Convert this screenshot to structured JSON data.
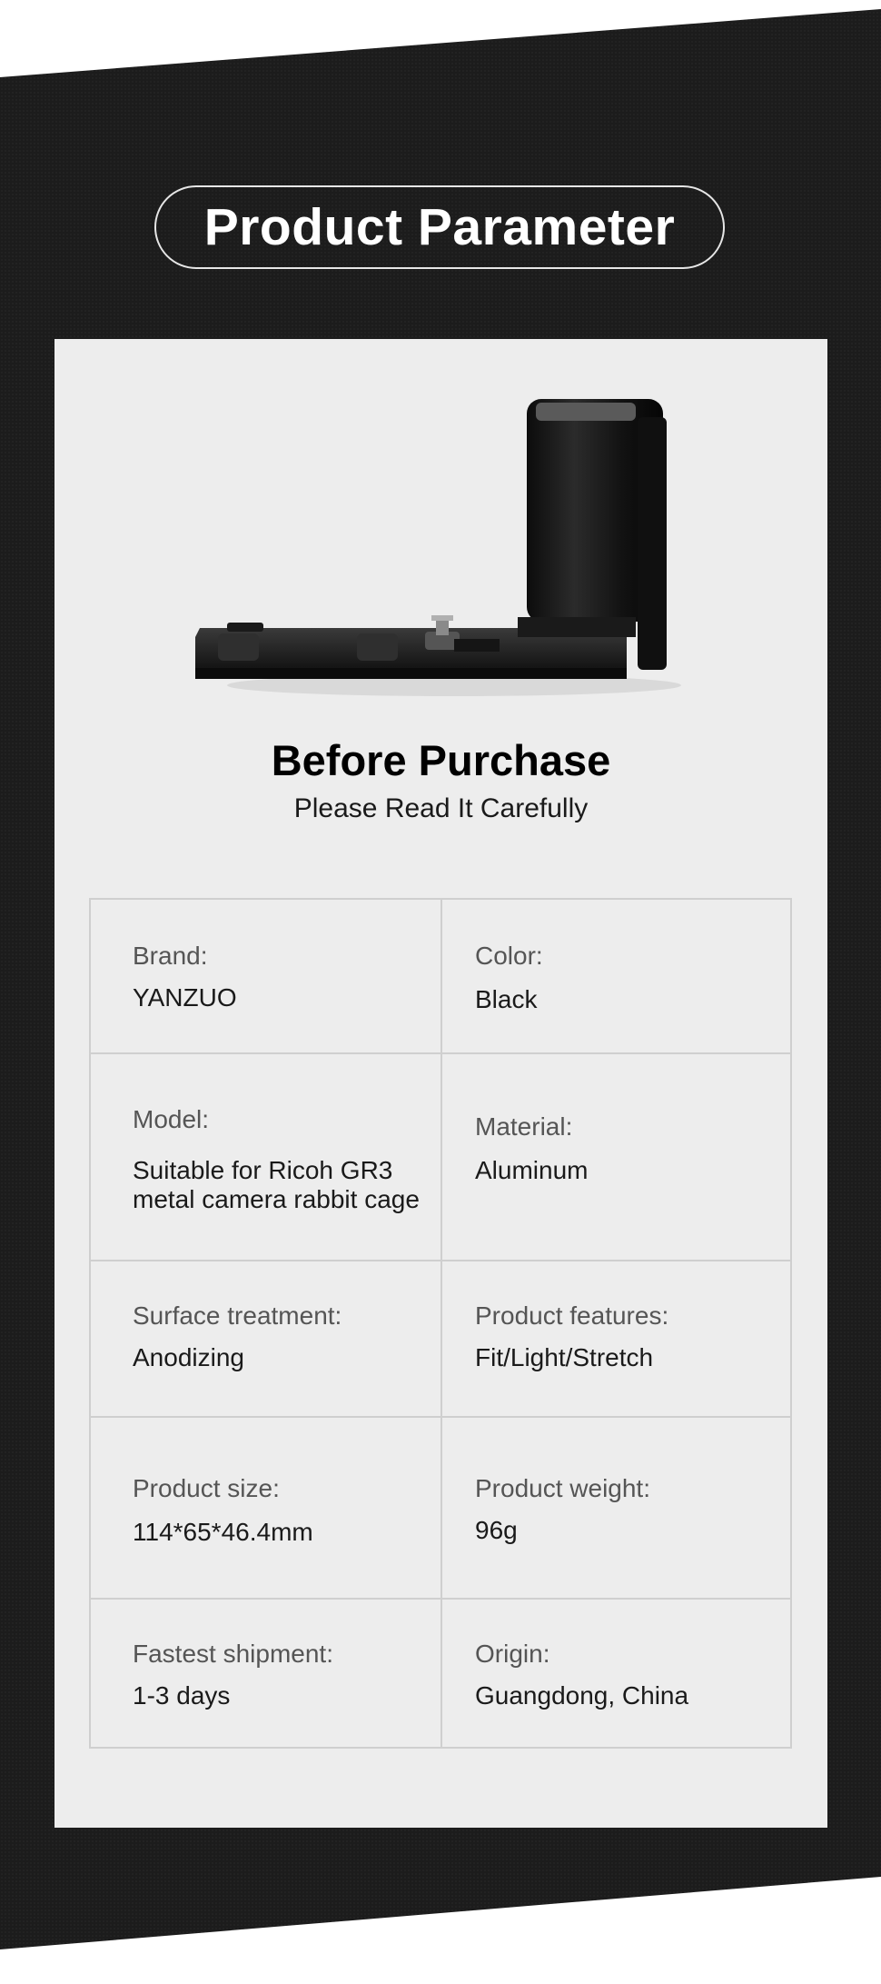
{
  "header": {
    "title": "Product Parameter"
  },
  "notice": {
    "title": "Before Purchase",
    "subtitle": "Please Read It Carefully"
  },
  "specs": [
    {
      "left": {
        "label": "Brand:",
        "value": "YANZUO"
      },
      "right": {
        "label": "Color:",
        "value": "Black"
      }
    },
    {
      "left": {
        "label": "Model:",
        "value": "Suitable for Ricoh GR3\nmetal camera rabbit cage"
      },
      "right": {
        "label": "Material:",
        "value": "Aluminum"
      }
    },
    {
      "left": {
        "label": "Surface treatment:",
        "value": "Anodizing"
      },
      "right": {
        "label": "Product features:",
        "value": "Fit/Light/Stretch"
      }
    },
    {
      "left": {
        "label": "Product size:",
        "value": "114*65*46.4mm"
      },
      "right": {
        "label": "Product weight:",
        "value": "96g"
      }
    },
    {
      "left": {
        "label": "Fastest shipment:",
        "value": "1-3 days"
      },
      "right": {
        "label": "Origin:",
        "value": "Guangdong, China"
      }
    }
  ],
  "colors": {
    "background": "#1c1c1c",
    "card": "#ededed",
    "border": "#cfcfcf"
  }
}
